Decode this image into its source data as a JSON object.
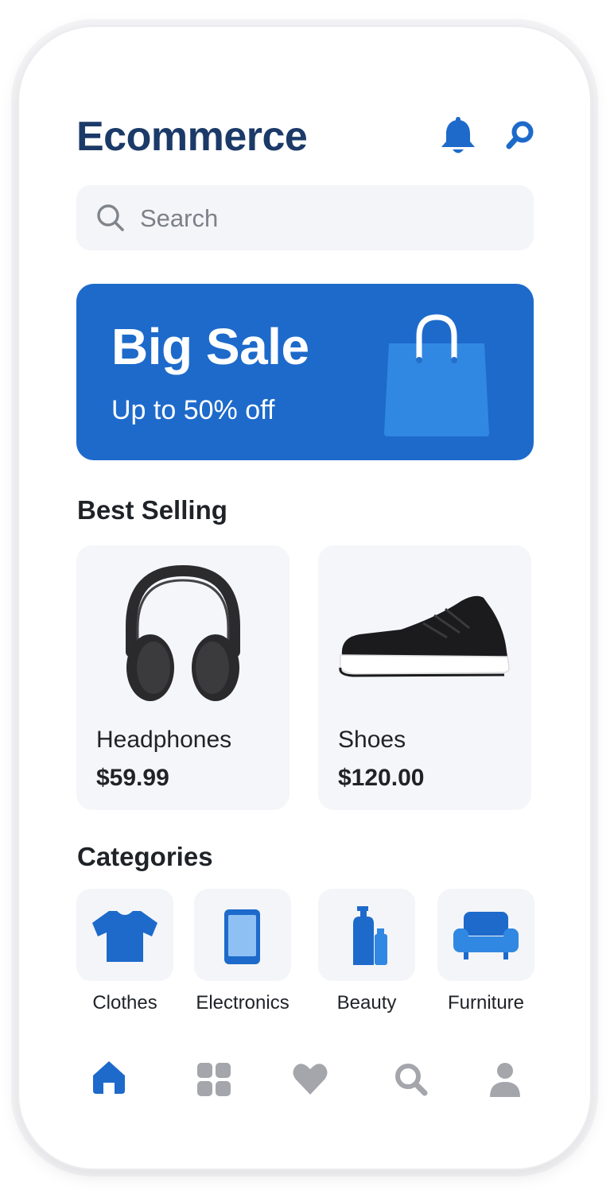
{
  "app": {
    "title": "Ecommerce"
  },
  "header": {
    "notification_icon": "bell-icon",
    "search_icon": "search-icon"
  },
  "search": {
    "placeholder": "Search",
    "value": ""
  },
  "banner": {
    "title": "Big Sale",
    "subtitle": "Up to 50% off",
    "icon": "shopping-bag-icon"
  },
  "best_selling": {
    "title": "Best Selling",
    "products": [
      {
        "name": "Headphones",
        "price": "$59.99",
        "image": "headphones"
      },
      {
        "name": "Shoes",
        "price": "$120.00",
        "image": "sneaker"
      }
    ]
  },
  "categories": {
    "title": "Categories",
    "items": [
      {
        "label": "Clothes",
        "icon": "tshirt-icon"
      },
      {
        "label": "Electronics",
        "icon": "tablet-icon"
      },
      {
        "label": "Beauty",
        "icon": "bottles-icon"
      },
      {
        "label": "Furniture",
        "icon": "armchair-icon"
      }
    ]
  },
  "bottom_nav": {
    "items": [
      {
        "icon": "home-icon",
        "active": true
      },
      {
        "icon": "grid-icon",
        "active": false
      },
      {
        "icon": "heart-icon",
        "active": false
      },
      {
        "icon": "search-icon",
        "active": false
      },
      {
        "icon": "profile-icon",
        "active": false
      }
    ]
  },
  "colors": {
    "accent": "#1d6acb",
    "title": "#1b3a68",
    "nav_inactive": "#a4a6ab",
    "card_bg": "#f5f6f9"
  }
}
